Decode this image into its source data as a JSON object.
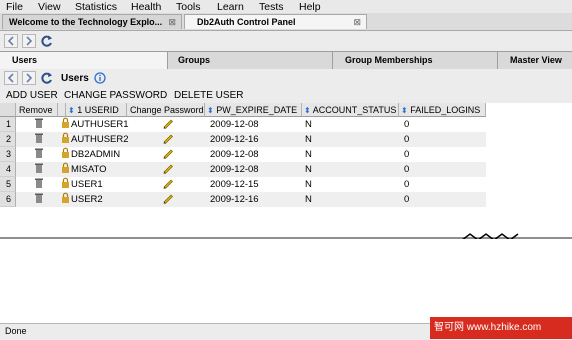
{
  "menu": [
    "File",
    "View",
    "Statistics",
    "Health",
    "Tools",
    "Learn",
    "Tests",
    "Help"
  ],
  "tabs": [
    {
      "label": "Welcome to the Technology Explo...",
      "close": "⊠"
    },
    {
      "label": "Db2Auth Control Panel",
      "close": "⊠"
    }
  ],
  "inner_tabs": [
    "Users",
    "Groups",
    "Group Memberships",
    "Master View"
  ],
  "section": {
    "title": "Users",
    "info_icon": "info-icon"
  },
  "actions": [
    "ADD USER",
    "CHANGE PASSWORD",
    "DELETE USER"
  ],
  "columns": {
    "remove": "Remove",
    "userid": "1 USERID",
    "change_password": "Change Password",
    "pw_expire": "PW_EXPIRE_DATE",
    "account_status": "ACCOUNT_STATUS",
    "failed_logins": "FAILED_LOGINS"
  },
  "rows": [
    {
      "num": "1",
      "userid": "AUTHUSER1",
      "pw_expire": "2009-12-08",
      "status": "N",
      "failed": "0"
    },
    {
      "num": "2",
      "userid": "AUTHUSER2",
      "pw_expire": "2009-12-16",
      "status": "N",
      "failed": "0"
    },
    {
      "num": "3",
      "userid": "DB2ADMIN",
      "pw_expire": "2009-12-08",
      "status": "N",
      "failed": "0"
    },
    {
      "num": "4",
      "userid": "MISATO",
      "pw_expire": "2009-12-08",
      "status": "N",
      "failed": "0"
    },
    {
      "num": "5",
      "userid": "USER1",
      "pw_expire": "2009-12-15",
      "status": "N",
      "failed": "0"
    },
    {
      "num": "6",
      "userid": "USER2",
      "pw_expire": "2009-12-16",
      "status": "N",
      "failed": "0"
    }
  ],
  "status": "Done",
  "watermark": "智可网 www.hzhike.com",
  "colors": {
    "accent_blue": "#2a6fd1",
    "watermark_red": "#d62b1e"
  }
}
